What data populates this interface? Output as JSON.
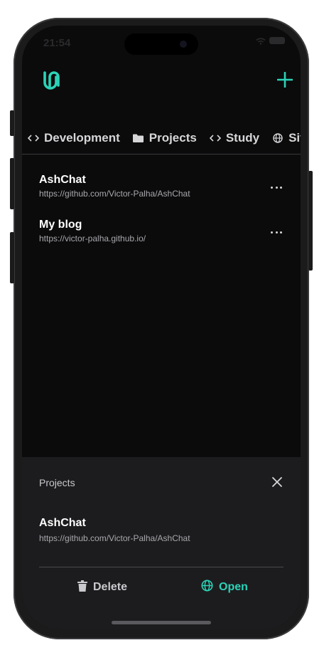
{
  "status": {
    "time": "21:54"
  },
  "header": {
    "logo_icon": "app-logo-icon",
    "add_icon": "plus-icon",
    "accent_color": "#2bd3b8"
  },
  "tabs": [
    {
      "label": "Development",
      "icon": "code-icon"
    },
    {
      "label": "Projects",
      "icon": "folder-icon"
    },
    {
      "label": "Study",
      "icon": "code-icon"
    },
    {
      "label": "Site",
      "icon": "globe-icon"
    }
  ],
  "items": [
    {
      "title": "AshChat",
      "url": "https://github.com/Victor-Palha/AshChat"
    },
    {
      "title": "My blog",
      "url": "https://victor-palha.github.io/"
    }
  ],
  "sheet": {
    "title": "Projects",
    "item_title": "AshChat",
    "item_url": "https://github.com/Victor-Palha/AshChat",
    "delete_label": "Delete",
    "open_label": "Open"
  }
}
